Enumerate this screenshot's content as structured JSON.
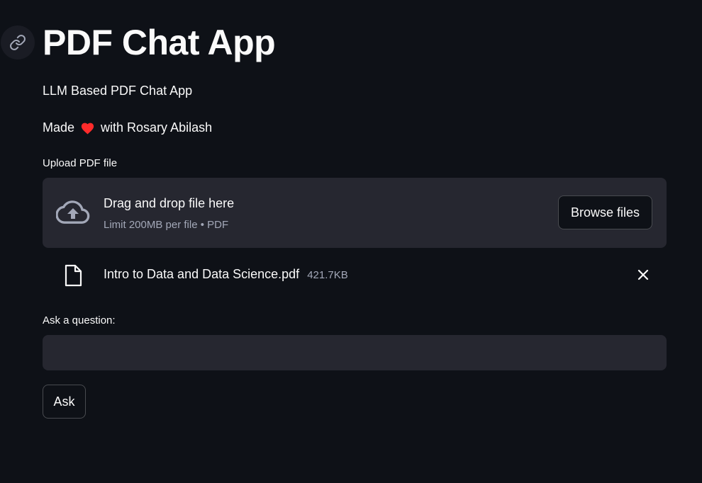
{
  "header": {
    "title": "PDF Chat App",
    "anchor_icon": "link-icon"
  },
  "intro": {
    "subtitle": "LLM Based PDF Chat App",
    "credit_prefix": "Made",
    "credit_icon": "heart-icon",
    "credit_suffix": "with Rosary Abilash"
  },
  "uploader": {
    "label": "Upload PDF file",
    "icon": "cloud-upload-icon",
    "drop_text": "Drag and drop file here",
    "limit_text": "Limit 200MB per file • PDF",
    "browse_label": "Browse files"
  },
  "uploaded_file": {
    "icon": "file-icon",
    "name": "Intro to Data and Data Science.pdf",
    "size": "421.7KB",
    "remove_icon": "close-icon"
  },
  "question": {
    "label": "Ask a question:",
    "value": "",
    "placeholder": ""
  },
  "actions": {
    "ask_label": "Ask"
  },
  "colors": {
    "background": "#0e1117",
    "surface": "#262730",
    "text": "#fafafa",
    "muted_text": "#a3a8b8",
    "heart": "#ff2b2b"
  }
}
